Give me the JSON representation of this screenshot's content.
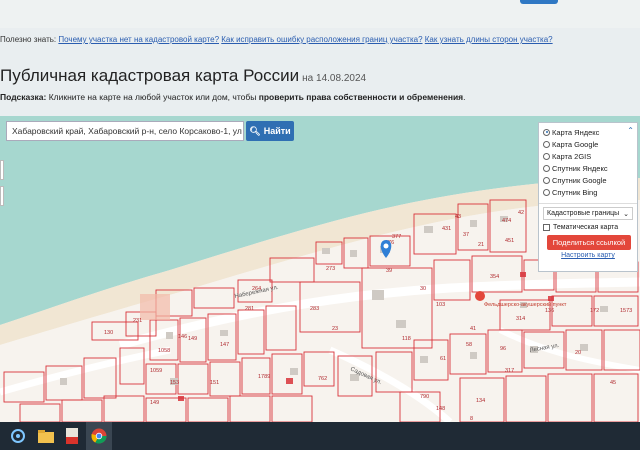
{
  "faq": {
    "prefix": "Полезно знать:",
    "links": [
      "Почему участка нет на кадастровой карте?",
      "Как исправить ошибку расположения границ участка?",
      "Как узнать длины сторон участка?"
    ]
  },
  "header": {
    "title": "Публичная кадастровая карта России",
    "date": "на 14.08.2024"
  },
  "hint": {
    "label": "Подсказка:",
    "text": "Кликните на карте на любой участок или дом, чтобы",
    "bold": "проверить права собственности и обременения",
    "end": "."
  },
  "search": {
    "value": "Хабаровский край, Хабаровский р-н, село Корсаково-1, ул Н",
    "button_label": "Найти"
  },
  "layer_panel": {
    "layers": [
      {
        "label": "Карта Яндекс",
        "selected": true
      },
      {
        "label": "Карта Google",
        "selected": false
      },
      {
        "label": "Карта 2GIS",
        "selected": false
      },
      {
        "label": "Спутник Яндекс",
        "selected": false
      },
      {
        "label": "Спутник Google",
        "selected": false
      },
      {
        "label": "Спутник Bing",
        "selected": false
      }
    ],
    "boundaries_select": "Кадастровые границы",
    "thematic_label": "Тематическая карта",
    "share_label": "Поделиться ссылкой",
    "setup_link": "Настроить карту"
  },
  "map": {
    "street_labels": [
      "Набережная ул.",
      "Садовая ул.",
      "Лесная ул."
    ],
    "poi_label": "Фельдшерско-акушерский пункт",
    "parcel_numbers": [
      "376",
      "377",
      "39",
      "30",
      "431",
      "273",
      "264",
      "37",
      "21",
      "474",
      "451",
      "42",
      "46",
      "43",
      "354",
      "130",
      "231",
      "281",
      "149",
      "147",
      "1058",
      "146",
      "1059",
      "151",
      "153",
      "149",
      "762",
      "1789",
      "314",
      "317",
      "148",
      "790",
      "134",
      "136",
      "172",
      "1573",
      "61",
      "58",
      "96",
      "41",
      "103",
      "118",
      "23",
      "283",
      "20",
      "45",
      "8"
    ]
  },
  "colors": {
    "search_button": "#2f6fb3",
    "share_button": "#e3473b",
    "parcel_border": "#d8333a",
    "water": "#a6d7cf",
    "pin": "#2f7fd6"
  },
  "taskbar": {
    "icons": [
      "windows-start-icon",
      "file-explorer-icon",
      "pdf-reader-icon",
      "chrome-browser-icon"
    ]
  }
}
